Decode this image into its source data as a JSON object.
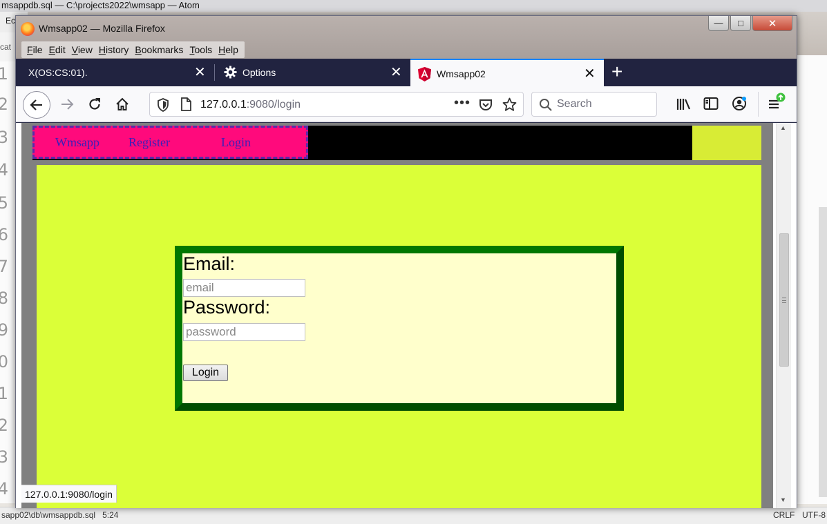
{
  "atom": {
    "title": "msappdb.sql — C:\\projects2022\\wmsapp — Atom",
    "menu_partial": "Ec",
    "tab_partial": "cat",
    "gutter_numbers": [
      "1",
      "2",
      "3",
      "4",
      "5",
      "6",
      "7",
      "8",
      "9",
      "0",
      "1",
      "2",
      "3",
      "4"
    ],
    "status_path": "sapp02\\db\\wmsappdb.sql",
    "status_cursor": "5:24",
    "status_eol": "CRLF",
    "status_encoding": "UTF-8"
  },
  "firefox": {
    "window_title": "Wmsapp02 — Mozilla Firefox",
    "menu": [
      "File",
      "Edit",
      "View",
      "History",
      "Bookmarks",
      "Tools",
      "Help"
    ],
    "tabs": [
      {
        "label": "X(OS:CS:01).",
        "selected": false
      },
      {
        "label": "Options",
        "selected": false,
        "icon": "gear-icon"
      },
      {
        "label": "Wmsapp02",
        "selected": true,
        "icon": "angular-icon"
      }
    ],
    "url_host": "127.0.0.1",
    "url_rest": ":9080/login",
    "search_placeholder": "Search",
    "status_url": "127.0.0.1:9080/login"
  },
  "page": {
    "nav_links": [
      "Wmsapp",
      "Register",
      "Login"
    ],
    "form": {
      "email_label": "Email:",
      "email_placeholder": "email",
      "password_label": "Password:",
      "password_placeholder": "password",
      "submit_label": "Login"
    }
  },
  "colors": {
    "nav_bg": "#ff0a7c",
    "nav_link": "#3a1fb8",
    "main_bg": "#dbff38",
    "form_border": "#006600",
    "form_bg": "#ffffcc",
    "firefox_tabbar": "#212340",
    "tab_accent": "#0a84ff"
  }
}
